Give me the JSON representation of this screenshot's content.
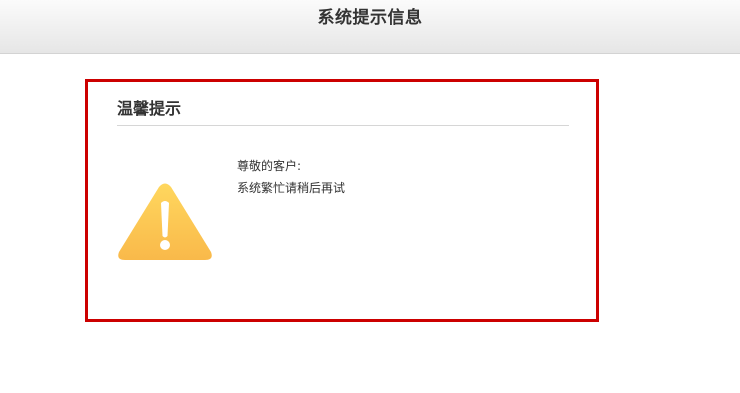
{
  "header": {
    "title": "系统提示信息"
  },
  "notice": {
    "title": "温馨提示",
    "greeting": "尊敬的客户:",
    "message": "系统繁忙请稍后再试"
  },
  "colors": {
    "border": "#cc0000",
    "warning_icon": "#fcc94d"
  }
}
